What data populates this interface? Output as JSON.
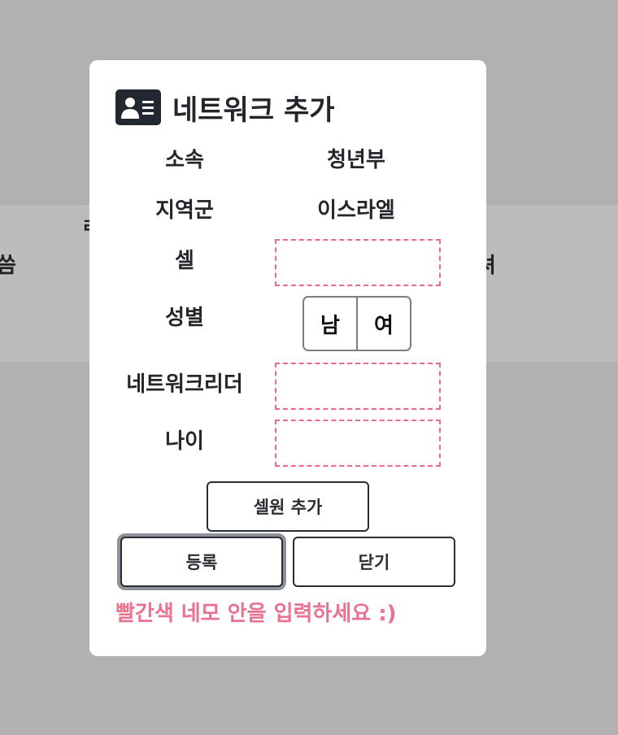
{
  "background": {
    "left_text": "씀",
    "right_text": "셔",
    "partial_label": "ㄹ"
  },
  "modal": {
    "title": "네트워크 추가",
    "title_icon": "contact-card-icon",
    "fields": {
      "affiliation": {
        "label": "소속",
        "value": "청년부"
      },
      "region": {
        "label": "지역군",
        "value": "이스라엘"
      },
      "cell": {
        "label": "셀",
        "value": "",
        "placeholder": ""
      },
      "gender": {
        "label": "성별",
        "options": [
          "남",
          "여"
        ]
      },
      "network_leader": {
        "label": "네트워크리더",
        "value": "",
        "placeholder": ""
      },
      "age": {
        "label": "나이",
        "value": "",
        "placeholder": ""
      }
    },
    "buttons": {
      "add_cell_member": "셀원 추가",
      "register": "등록",
      "close": "닫기"
    },
    "hint": "빨간색 네모 안을 입력하세요 :)",
    "colors": {
      "required_border": "#e86a86",
      "hint": "#e8728f",
      "icon_bg": "#222830"
    }
  }
}
